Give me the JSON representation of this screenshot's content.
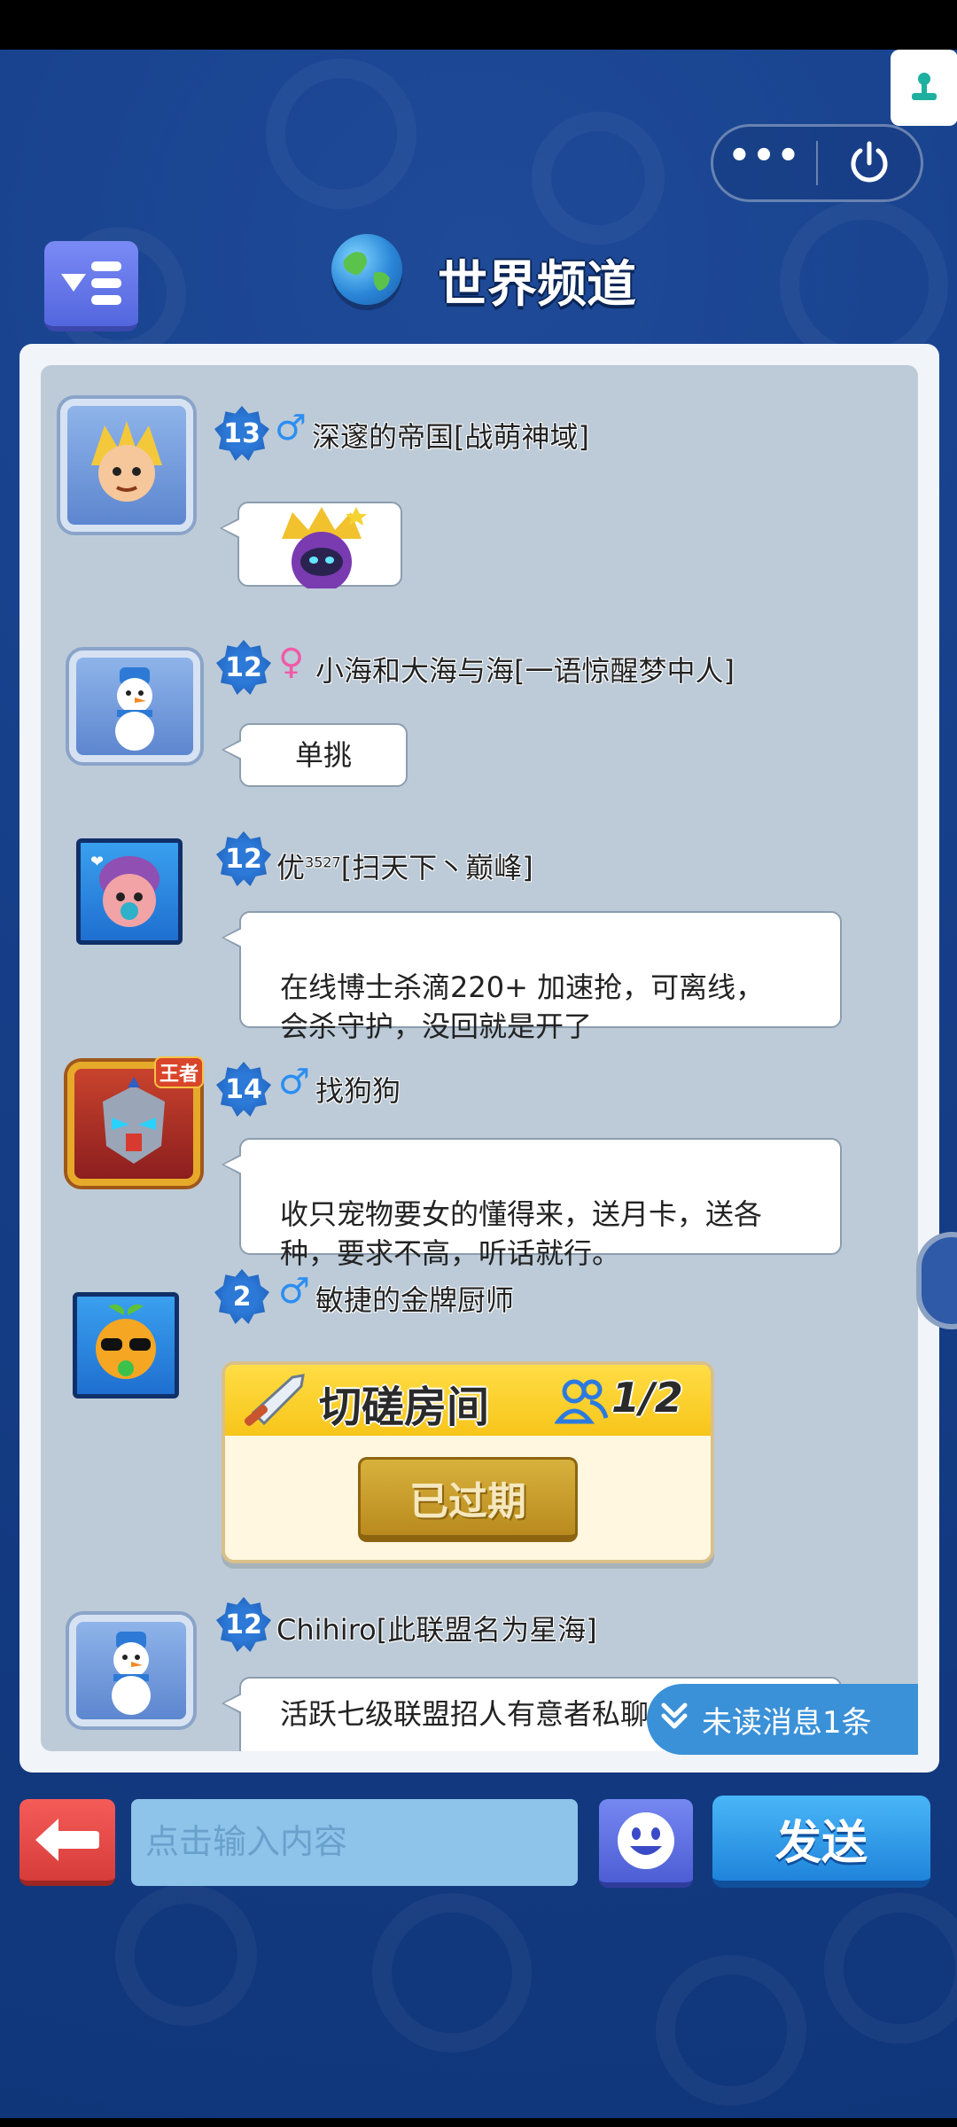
{
  "header": {
    "title": "世界频道",
    "more_label": "•••"
  },
  "messages": [
    {
      "level": "13",
      "gender": "♂",
      "name": "深邃的帝国[战萌神域]",
      "bubble_type": "sticker"
    },
    {
      "level": "12",
      "gender": "♀",
      "name": "小海和大海与海[一语惊醒梦中人]",
      "text": "单挑"
    },
    {
      "level": "12",
      "gender": "",
      "name": "优",
      "name_sup": "3527",
      "name_suffix": "[扫天下丶巅峰]",
      "text": "在线博士杀滴220+ 加速抢，可离线，\n会杀守护，没回就是开了"
    },
    {
      "level": "14",
      "gender": "♂",
      "name": "找狗狗",
      "avatar_badge": "王者",
      "text": "收只宠物要女的懂得来，送月卡，送各\n种，要求不高，听话就行。"
    },
    {
      "level": "2",
      "gender": "♂",
      "name": "敏捷的金牌厨师",
      "room": {
        "title": "切磋房间",
        "count": "1/2",
        "status": "已过期"
      }
    },
    {
      "level": "12",
      "gender": "",
      "name": "Chihiro[此联盟名为星海]",
      "text": "活跃七级联盟招人有意者私聊"
    }
  ],
  "unread": {
    "label": "未读消息1条"
  },
  "composer": {
    "placeholder": "点击输入内容",
    "send_label": "发送"
  }
}
